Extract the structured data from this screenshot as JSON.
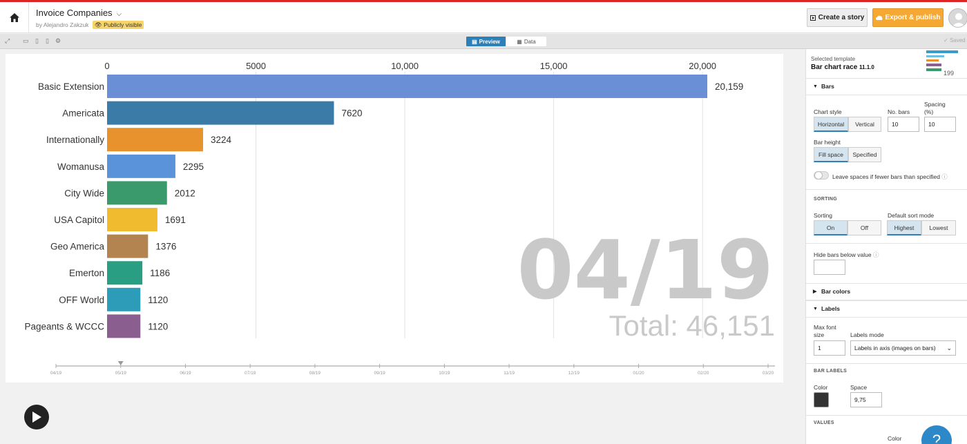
{
  "app": {
    "title": "Invoice Companies",
    "author": "by Alejandro Zakzuk",
    "visibility": "Publicly visible",
    "create_story": "Create a story",
    "export_publish": "Export & publish",
    "saved": "Saved"
  },
  "toolbar": {
    "preview_tab": "Preview",
    "data_tab": "Data"
  },
  "chart_data": {
    "type": "bar",
    "orientation": "horizontal",
    "categories": [
      "Basic Extension",
      "Americata",
      "Internationally",
      "Womanusa",
      "City Wide",
      "USA Capitol",
      "Geo America",
      "Emerton",
      "OFF World",
      "Pageants & WCCC"
    ],
    "values": [
      20159,
      7620,
      3224,
      2295,
      2012,
      1691,
      1376,
      1186,
      1120,
      1120
    ],
    "value_labels": [
      "20,159",
      "7620",
      "3224",
      "2295",
      "2012",
      "1691",
      "1376",
      "1186",
      "1120",
      "1120"
    ],
    "colors": [
      "#6b8fd6",
      "#3b7ba8",
      "#e8922e",
      "#5b93da",
      "#3a9a6c",
      "#f0bb2f",
      "#b38350",
      "#2a9e82",
      "#2d9cb8",
      "#8a5f90"
    ],
    "xlim": [
      0,
      20159
    ],
    "x_ticks": [
      0,
      5000,
      10000,
      15000,
      20000
    ],
    "x_tick_labels": [
      "0",
      "5000",
      "10,000",
      "15,000",
      "20,000"
    ],
    "date_label": "04/19",
    "total_label": "Total: 46,151",
    "timeline_labels": [
      "04/19",
      "05/19",
      "06/19",
      "07/19",
      "08/19",
      "09/19",
      "10/19",
      "11/19",
      "12/19",
      "01/20",
      "02/20",
      "03/20"
    ],
    "timeline_marker_index": 1,
    "grid": true
  },
  "panel": {
    "selected_template_label": "Selected template",
    "template_name": "Bar chart race",
    "template_version": "11.1.0",
    "thumb_text": "199",
    "bars_section": "Bars",
    "chart_style_label": "Chart style",
    "chart_style_options": [
      "Horizontal",
      "Vertical"
    ],
    "no_bars_label": "No. bars",
    "no_bars_value": "10",
    "spacing_label_1": "Spacing",
    "spacing_label_2": "(%)",
    "spacing_value": "10",
    "bar_height_label": "Bar height",
    "bar_height_options": [
      "Fill space",
      "Specified"
    ],
    "leave_spaces_label": "Leave spaces if fewer bars than specified",
    "sorting_caps": "SORTING",
    "sorting_label": "Sorting",
    "sorting_options": [
      "On",
      "Off"
    ],
    "default_sort_label": "Default sort mode",
    "default_sort_options": [
      "Highest",
      "Lowest"
    ],
    "hide_bars_label": "Hide bars below value",
    "bar_colors_section": "Bar colors",
    "labels_section": "Labels",
    "max_font_label_1": "Max font",
    "max_font_label_2": "size",
    "max_font_value": "1",
    "labels_mode_label": "Labels mode",
    "labels_mode_value": "Labels in axis (images on bars)",
    "bar_labels_caps": "BAR LABELS",
    "color_label": "Color",
    "space_label": "Space",
    "space_value": "9,75",
    "values_caps": "VALUES",
    "values_color_label": "Color",
    "help_label": "?"
  }
}
